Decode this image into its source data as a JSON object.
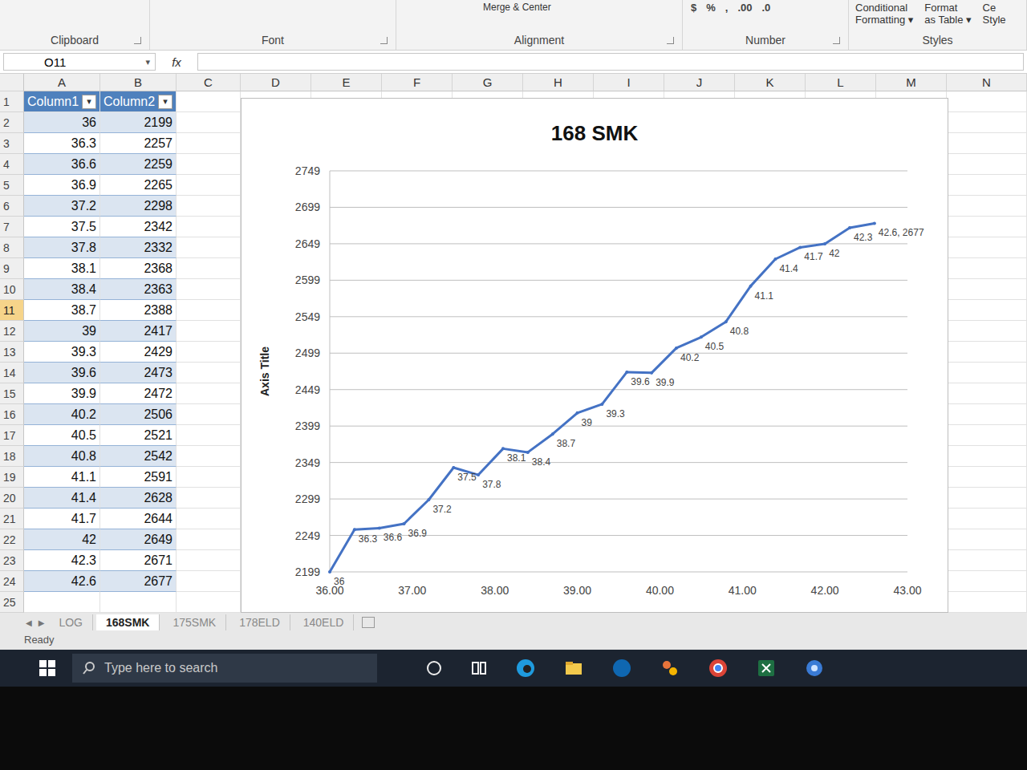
{
  "ribbon": {
    "merge_label": "Merge & Center",
    "number_buttons": [
      "$",
      "%",
      ",",
      ".00",
      ".0"
    ],
    "style_buttons": [
      {
        "top": "Conditional",
        "bottom": "Formatting ▾"
      },
      {
        "top": "Format",
        "bottom": "as Table ▾"
      },
      {
        "top": "Ce",
        "bottom": "Style"
      }
    ],
    "groups": [
      "Clipboard",
      "Font",
      "Alignment",
      "Number",
      "Styles"
    ]
  },
  "formula_bar": {
    "name_box": "O11",
    "name_box_arrow": "▾",
    "fx": "fx",
    "value": ""
  },
  "columns": [
    "A",
    "B",
    "C",
    "D",
    "E",
    "F",
    "G",
    "H",
    "I",
    "J",
    "K",
    "L",
    "M",
    "N"
  ],
  "table": {
    "headers": [
      "Column1",
      "Column2"
    ],
    "filter_icon": "▾",
    "header_row": "1",
    "rows": [
      {
        "num": "2",
        "a": "36",
        "b": "2199",
        "selected": false
      },
      {
        "num": "3",
        "a": "36.3",
        "b": "2257",
        "selected": false
      },
      {
        "num": "4",
        "a": "36.6",
        "b": "2259",
        "selected": false
      },
      {
        "num": "5",
        "a": "36.9",
        "b": "2265",
        "selected": false
      },
      {
        "num": "6",
        "a": "37.2",
        "b": "2298",
        "selected": false
      },
      {
        "num": "7",
        "a": "37.5",
        "b": "2342",
        "selected": false
      },
      {
        "num": "8",
        "a": "37.8",
        "b": "2332",
        "selected": false
      },
      {
        "num": "9",
        "a": "38.1",
        "b": "2368",
        "selected": false
      },
      {
        "num": "10",
        "a": "38.4",
        "b": "2363",
        "selected": false
      },
      {
        "num": "11",
        "a": "38.7",
        "b": "2388",
        "selected": true
      },
      {
        "num": "12",
        "a": "39",
        "b": "2417",
        "selected": false
      },
      {
        "num": "13",
        "a": "39.3",
        "b": "2429",
        "selected": false
      },
      {
        "num": "14",
        "a": "39.6",
        "b": "2473",
        "selected": false
      },
      {
        "num": "15",
        "a": "39.9",
        "b": "2472",
        "selected": false
      },
      {
        "num": "16",
        "a": "40.2",
        "b": "2506",
        "selected": false
      },
      {
        "num": "17",
        "a": "40.5",
        "b": "2521",
        "selected": false
      },
      {
        "num": "18",
        "a": "40.8",
        "b": "2542",
        "selected": false
      },
      {
        "num": "19",
        "a": "41.1",
        "b": "2591",
        "selected": false
      },
      {
        "num": "20",
        "a": "41.4",
        "b": "2628",
        "selected": false
      },
      {
        "num": "21",
        "a": "41.7",
        "b": "2644",
        "selected": false
      },
      {
        "num": "22",
        "a": "42",
        "b": "2649",
        "selected": false
      },
      {
        "num": "23",
        "a": "42.3",
        "b": "2671",
        "selected": false
      },
      {
        "num": "24",
        "a": "42.6",
        "b": "2677",
        "selected": false
      }
    ],
    "empty_rows": [
      "25"
    ]
  },
  "chart": {
    "title": "168 SMK",
    "y_axis_title": "Axis Title",
    "y_ticks": [
      "2199",
      "2249",
      "2299",
      "2349",
      "2399",
      "2449",
      "2499",
      "2549",
      "2599",
      "2649",
      "2699",
      "2749"
    ],
    "x_ticks": [
      "36.00",
      "37.00",
      "38.00",
      "39.00",
      "40.00",
      "41.00",
      "42.00",
      "43.00"
    ],
    "series": [
      {
        "name": "Column2",
        "color": "#4472c4",
        "x": [
          36,
          36.3,
          36.6,
          36.9,
          37.2,
          37.5,
          37.8,
          38.1,
          38.4,
          38.7,
          39,
          39.3,
          39.6,
          39.9,
          40.2,
          40.5,
          40.8,
          41.1,
          41.4,
          41.7,
          42,
          42.3,
          42.6
        ],
        "y": [
          2199,
          2257,
          2259,
          2265,
          2298,
          2342,
          2332,
          2368,
          2363,
          2388,
          2417,
          2429,
          2473,
          2472,
          2506,
          2521,
          2542,
          2591,
          2628,
          2644,
          2649,
          2671,
          2677
        ],
        "labels": [
          "36",
          "36.3",
          "36.6",
          "36.9",
          "37.2",
          "37.5",
          "37.8",
          "38.1",
          "38.4",
          "38.7",
          "39",
          "39.3",
          "39.6",
          "39.9",
          "40.2",
          "40.5",
          "40.8",
          "41.1",
          "41.4",
          "41.7",
          "42",
          "42.3",
          "42.6, 2677"
        ]
      }
    ]
  },
  "sheet_nav": [
    "◀",
    "▶"
  ],
  "sheet_tabs": [
    {
      "label": "LOG",
      "selected": false
    },
    {
      "label": "168SMK",
      "selected": true
    },
    {
      "label": "175SMK",
      "selected": false
    },
    {
      "label": "178ELD",
      "selected": false
    },
    {
      "label": "140ELD",
      "selected": false
    }
  ],
  "status": "Ready",
  "taskbar": {
    "search_placeholder": "Type here to search"
  }
}
